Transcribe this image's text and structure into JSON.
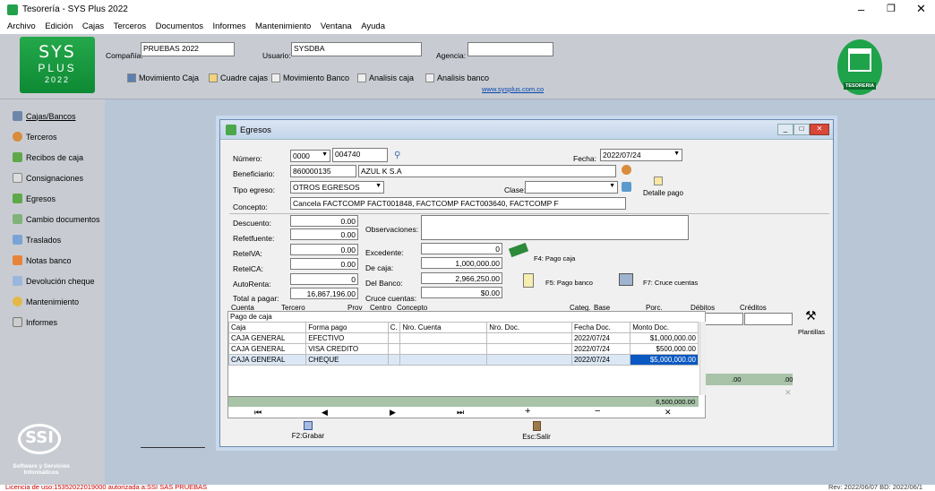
{
  "window": {
    "title": "Tesorería - SYS Plus 2022"
  },
  "menu": [
    "Archivo",
    "Edición",
    "Cajas",
    "Terceros",
    "Documentos",
    "Informes",
    "Mantenimiento",
    "Ventana",
    "Ayuda"
  ],
  "header": {
    "logo": {
      "line1": "SYS",
      "line2": "PLUS",
      "line3": "2022"
    },
    "compania_label": "Compañía:",
    "compania_value": "PRUEBAS 2022",
    "usuario_label": "Usuario:",
    "usuario_value": "SYSDBA",
    "agencia_label": "Agencia:",
    "agencia_value": "",
    "toolbar": [
      "Movimiento Caja",
      "Cuadre cajas",
      "Movimiento Banco",
      "Analisis caja",
      "Analisis banco"
    ],
    "website": "www.sysplus.com.co",
    "badge": "TESORERIA"
  },
  "sidebar": {
    "items": [
      "Cajas/Bancos",
      "Terceros",
      "Recibos de caja",
      "Consignaciones",
      "Egresos",
      "Cambio documentos",
      "Traslados",
      "Notas banco",
      "Devolución cheque",
      "Mantenimiento",
      "Informes"
    ],
    "footer_logo": "SSI",
    "footer_text1": "Software y Servicios",
    "footer_text2": "Informáticos"
  },
  "status": {
    "license": "Licencia de uso:15352022019000 autorizada a:SSI SAS PRUEBAS",
    "rev": "Rev: 2022/06/07 BD: 2022/06/1"
  },
  "dialog": {
    "title": "Egresos",
    "numero_label": "Número:",
    "numero_prefix": "0000",
    "numero_value": "004740",
    "fecha_label": "Fecha:",
    "fecha_value": "2022/07/24",
    "beneficiario_label": "Beneficiario:",
    "beneficiario_nit": "860000135",
    "beneficiario_name": "AZUL K S.A",
    "tipo_label": "Tipo egreso:",
    "tipo_value": "OTROS EGRESOS",
    "clase_label": "Clase:",
    "clase_value": "",
    "detalle_pago": "Detalle pago",
    "concepto_label": "Concepto:",
    "concepto_value": "Cancela FACTCOMP FACT001848, FACTCOMP FACT003640, FACTCOMP F",
    "descuento_label": "Descuento:",
    "descuento_value": "0.00",
    "retefuente_label": "Refetfuente:",
    "retefuente_value": "0.00",
    "reteiva_label": "RetelVA:",
    "reteiva_value": "0.00",
    "reteica_label": "RetelCA:",
    "reteica_value": "0.00",
    "autorenta_label": "AutoRenta:",
    "autorenta_value": "0",
    "total_label": "Total a pagar:",
    "total_value": "16,867,196.00",
    "observaciones_label": "Observaciones:",
    "excedente_label": "Excedente:",
    "excedente_value": "0",
    "decaja_label": "De caja:",
    "decaja_value": "1,000,000.00",
    "delbanco_label": "Del Banco:",
    "delbanco_value": "2,966,250.00",
    "cruce_label": "Cruce cuentas:",
    "cruce_value": "$0.00",
    "f4": "F4: Pago caja",
    "f5": "F5: Pago banco",
    "f7": "F7: Cruce cuentas",
    "acct_headers": [
      "Cuenta",
      "Tercero",
      "Prov",
      "Centro",
      "Concepto",
      "Categ.",
      "Base",
      "Porc.",
      "Débitos",
      "Créditos"
    ],
    "plantillas": "Plantillas",
    "totals_debitos": ".00",
    "totals_creditos": ".00",
    "pago_caja": {
      "title": "Pago de caja",
      "headers": [
        "Caja",
        "Forma pago",
        "C.",
        "Nro. Cuenta",
        "Nro. Doc.",
        "Fecha Doc.",
        "Monto Doc."
      ],
      "rows": [
        [
          "CAJA GENERAL",
          "EFECTIVO",
          "",
          "",
          "",
          "2022/07/24",
          "$1,000,000.00"
        ],
        [
          "CAJA GENERAL",
          "VISA CREDITO",
          "",
          "",
          "",
          "2022/07/24",
          "$500,000.00"
        ],
        [
          "CAJA GENERAL",
          "CHEQUE",
          "",
          "",
          "",
          "2022/07/24",
          "$5,000,000.00"
        ]
      ],
      "total": "6,500,000.00"
    },
    "nav": [
      "⏮",
      "◀",
      "▶",
      "⏭",
      "+",
      "−",
      "✕"
    ],
    "grabar": "F2:Grabar",
    "salir": "Esc:Salir"
  }
}
